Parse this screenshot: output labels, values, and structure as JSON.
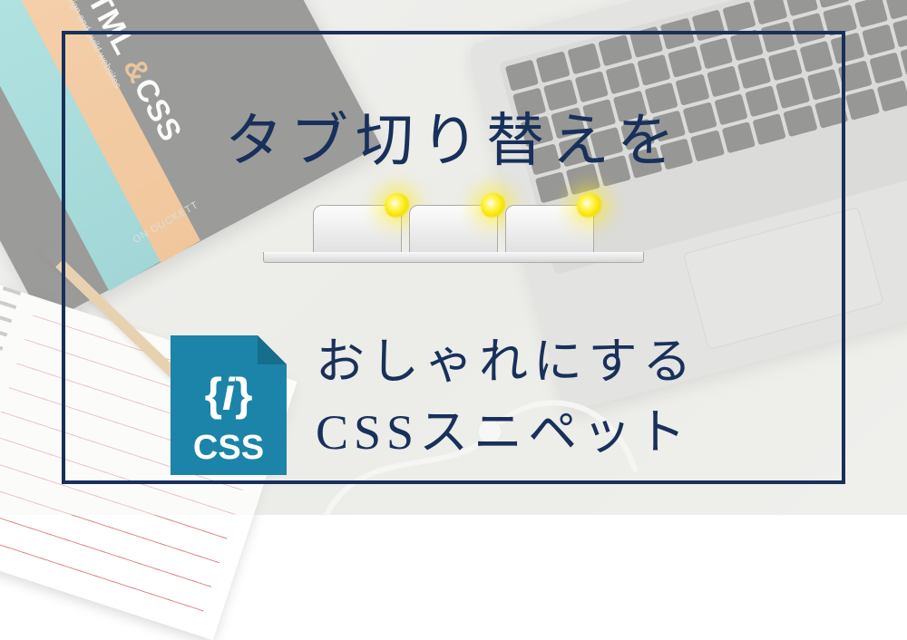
{
  "book": {
    "title_html": "HTML",
    "title_amp": "&",
    "title_css": "CSS",
    "subtitle": "design and build websites",
    "author": "ON DUCKETT"
  },
  "headline": {
    "line1": "タブ切り替えを",
    "line2": "おしゃれにする",
    "line3": "CSSスニペット"
  },
  "css_badge": {
    "braces": "{i}",
    "label": "CSS"
  },
  "tabs": {
    "count": 3
  },
  "colors": {
    "frame": "#18305a",
    "badge": "#1c84a8",
    "bulb": "#f5df00"
  }
}
